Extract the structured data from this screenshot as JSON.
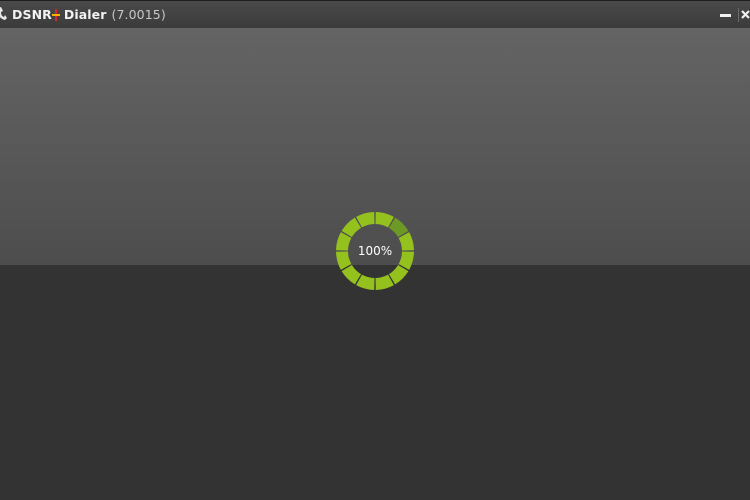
{
  "titlebar": {
    "brand_prefix": "DSNR",
    "app_name": "Dialer",
    "version": "(7.0015)",
    "icons": {
      "app": "phone-icon",
      "minimize": "minimize-icon",
      "close": "close-icon"
    }
  },
  "loader": {
    "percent_label": "100%",
    "progress": 1.0
  },
  "colors": {
    "ring_light": "#95c11f",
    "ring_dark": "#6d9a24",
    "upper_top": "#646464",
    "upper_bottom": "#4d4d4d",
    "lower": "#333333",
    "titlebar": "#3f3f3f",
    "brand_plus_red": "#d9262b",
    "brand_plus_yellow": "#f5b400"
  }
}
